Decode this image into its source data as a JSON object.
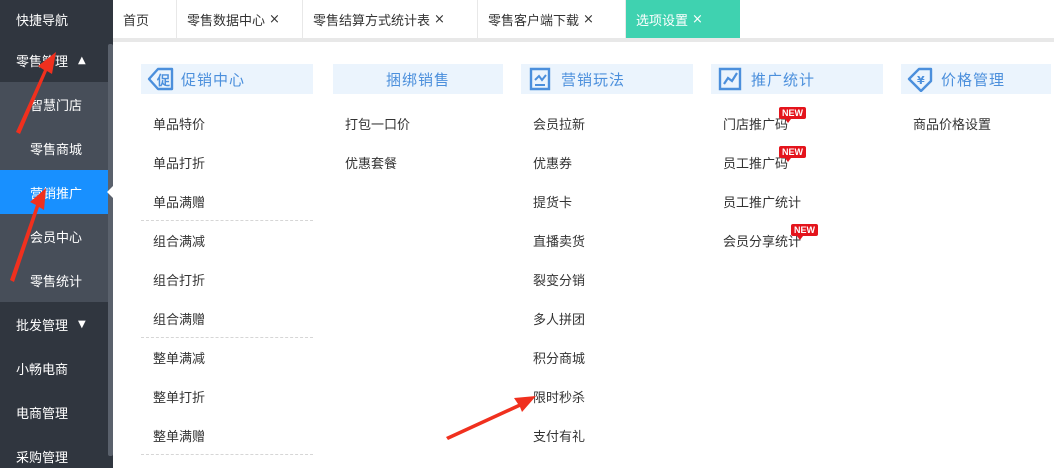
{
  "sidebar": {
    "quick_nav": "快捷导航",
    "retail": "零售管理",
    "retail_caret": "▲",
    "retail_items": [
      "智慧门店",
      "零售商城",
      "营销推广",
      "会员中心",
      "零售统计"
    ],
    "wholesale": "批发管理",
    "wholesale_caret": "▼",
    "after": [
      "小畅电商",
      "电商管理",
      "采购管理"
    ]
  },
  "tabs": [
    {
      "label": "首页",
      "close": ""
    },
    {
      "label": "零售数据中心",
      "close": "×"
    },
    {
      "label": "零售结算方式统计表",
      "close": "×"
    },
    {
      "label": "零售客户端下载",
      "close": "×"
    },
    {
      "label": "选项设置",
      "close": "×"
    }
  ],
  "columns": [
    {
      "title": "促销中心",
      "icon": "promotion-icon",
      "items": [
        "单品特价",
        "单品打折",
        "单品满赠",
        "组合满减",
        "组合打折",
        "组合满赠",
        "整单满减",
        "整单打折",
        "整单满赠"
      ]
    },
    {
      "title": "捆绑销售",
      "icon": "",
      "items": [
        "打包一口价",
        "优惠套餐"
      ]
    },
    {
      "title": "营销玩法",
      "icon": "marketing-icon",
      "items": [
        "会员拉新",
        "优惠券",
        "提货卡",
        "直播卖货",
        "裂变分销",
        "多人拼团",
        "积分商城",
        "限时秒杀",
        "支付有礼"
      ]
    },
    {
      "title": "推广统计",
      "icon": "chart-icon",
      "items": [
        "门店推广码",
        "员工推广码",
        "员工推广统计",
        "会员分享统计"
      ]
    },
    {
      "title": "价格管理",
      "icon": "price-icon",
      "items": [
        "商品价格设置"
      ]
    }
  ],
  "new_badge": "NEW",
  "colors": {
    "sidebar": "#30363f",
    "submenu": "#474e59",
    "active": "#1890ff",
    "tab_active": "#3fd2b0",
    "header_bg": "#ebf4fd",
    "header_text": "#4b8fdc",
    "badge": "#e4141c",
    "annotation": "#f0301e"
  }
}
